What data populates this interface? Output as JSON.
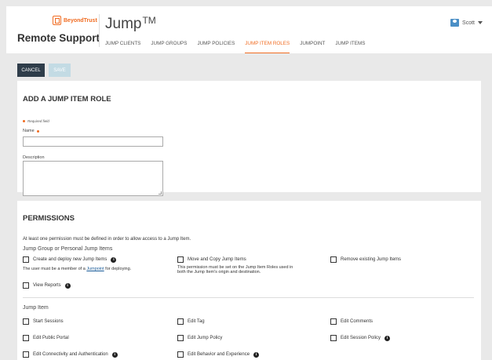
{
  "brand": {
    "logo_text": "BeyondTrust",
    "app_name": "Remote Support"
  },
  "page": {
    "title": "Jump",
    "trademark": "TM"
  },
  "nav": {
    "tabs": [
      {
        "label": "JUMP CLIENTS",
        "active": false
      },
      {
        "label": "JUMP GROUPS",
        "active": false
      },
      {
        "label": "JUMP POLICIES",
        "active": false
      },
      {
        "label": "JUMP ITEM ROLES",
        "active": true
      },
      {
        "label": "JUMPOINT",
        "active": false
      },
      {
        "label": "JUMP ITEMS",
        "active": false
      }
    ]
  },
  "user": {
    "name": "Scott",
    "icon": "user-card-icon"
  },
  "actions": {
    "cancel_label": "CANCEL",
    "save_label": "SAVE"
  },
  "form": {
    "title": "ADD A JUMP ITEM ROLE",
    "required_note": "Required field",
    "name_label": "Name",
    "name_value": "",
    "description_label": "Description",
    "description_value": ""
  },
  "permissions": {
    "title": "PERMISSIONS",
    "note": "At least one permission must be defined in order to allow access to a Jump Item.",
    "group_section": "Jump Group or Personal Jump Items",
    "create_deploy": "Create and deploy new Jump Items",
    "create_deploy_sub_prefix": "The user must be a member of a ",
    "create_deploy_sub_link": "Jumpoint",
    "create_deploy_sub_suffix": " for deploying.",
    "move_copy": "Move and Copy Jump Items",
    "move_copy_sub_1": "This permission must be set on the Jump Item Roles used in",
    "move_copy_sub_2": "both the Jump Item's origin and destination.",
    "remove_existing": "Remove existing Jump Items",
    "view_reports": "View Reports",
    "item_section": "Jump Item",
    "start_sessions": "Start Sessions",
    "edit_tag": "Edit Tag",
    "edit_comments": "Edit Comments",
    "edit_public_portal": "Edit Public Portal",
    "edit_jump_policy": "Edit Jump Policy",
    "edit_session_policy": "Edit Session Policy",
    "edit_connectivity": "Edit Connectivity and Authentication",
    "edit_behavior": "Edit Behavior and Experience"
  },
  "colors": {
    "accent": "#f06c22",
    "cancel_bg": "#2f3d4a",
    "save_bg": "#c3dbe4",
    "link": "#1a5c99"
  }
}
